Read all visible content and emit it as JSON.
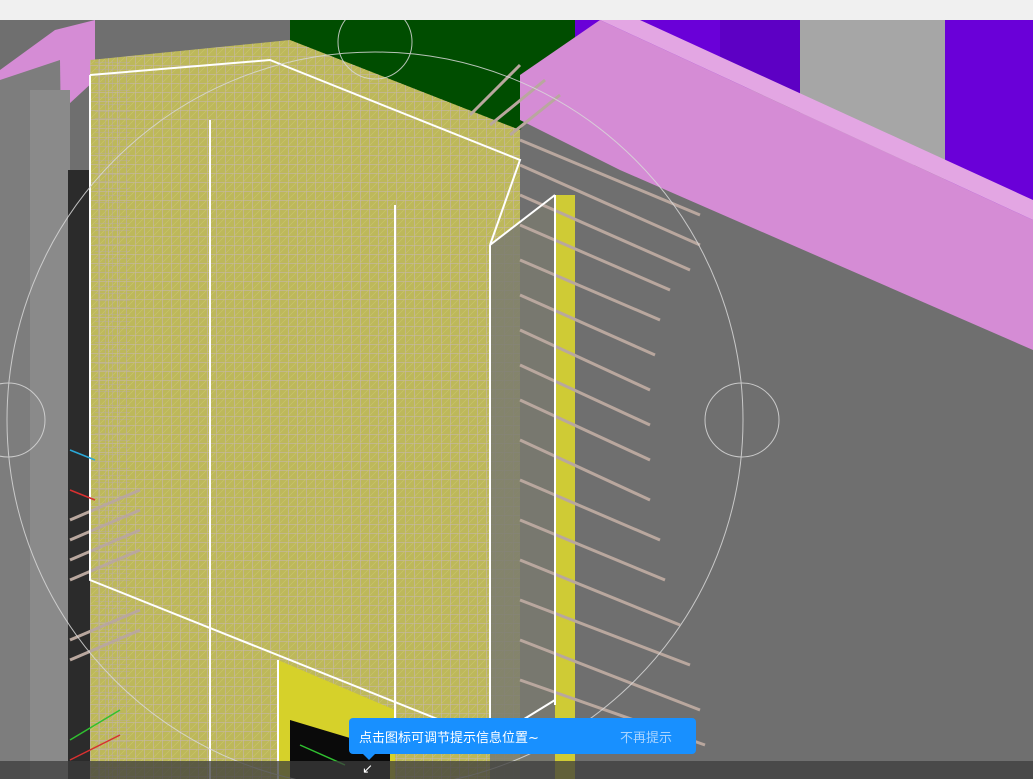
{
  "tooltip": {
    "message": "点击图标可调节提示信息位置~",
    "dismiss_label": "不再提示"
  },
  "icons": {
    "position_adjust": "move-corner-icon",
    "glyph": "↙"
  },
  "colors": {
    "background": "#6f6f6f",
    "wall_gray": "#777777",
    "beam_pink": "#d58cd5",
    "column_purple": "#6600d6",
    "slab_green": "#004d00",
    "panel_yellow": "#d7d22a",
    "rebar": "#b7a9a0",
    "outline": "#ffffff",
    "tooltip_bg": "#1890ff"
  }
}
